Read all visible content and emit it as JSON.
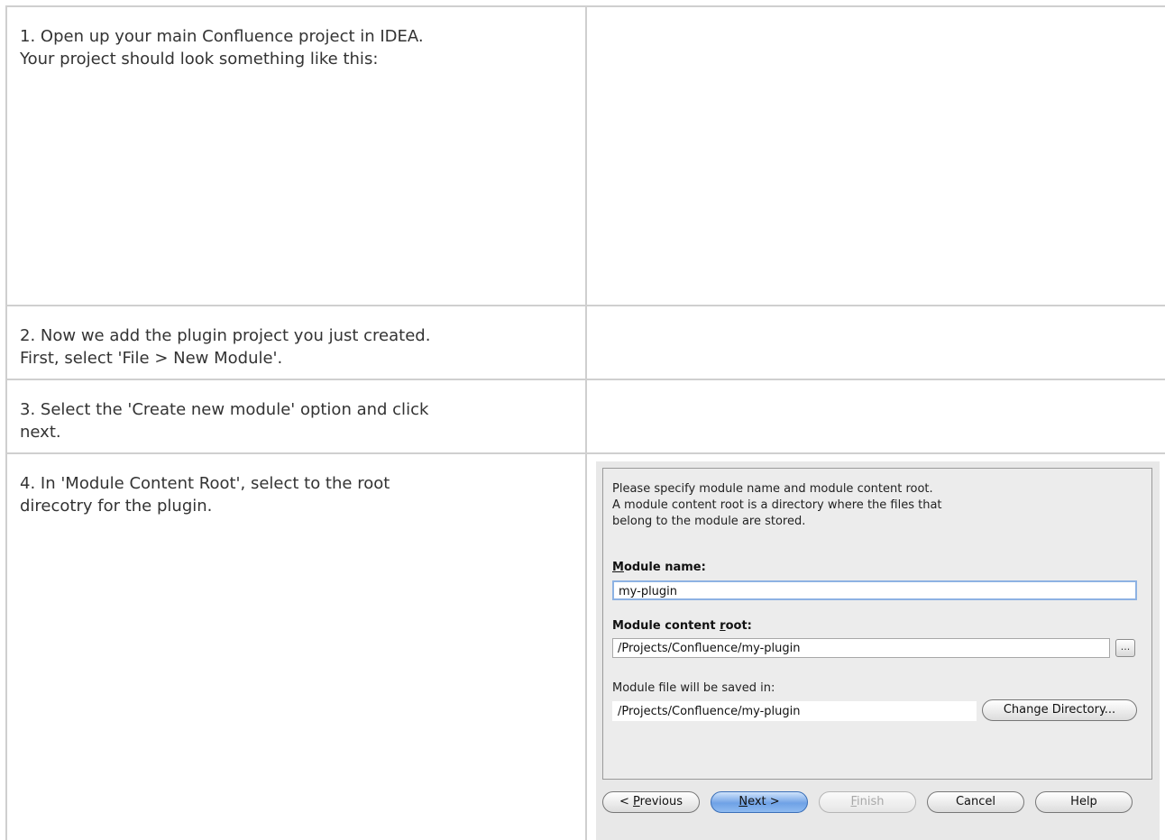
{
  "steps": [
    {
      "lines": [
        "1. Open up your main Confluence project in IDEA.",
        "Your project should look something like this:"
      ]
    },
    {
      "lines": [
        "2. Now we add the plugin project you just created.",
        "First, select 'File > New Module'."
      ]
    },
    {
      "lines": [
        "3. Select the 'Create new module' option and click",
        "next."
      ]
    },
    {
      "lines": [
        "4. In 'Module Content Root', select to the root",
        "direcotry for the plugin."
      ]
    }
  ],
  "dialog": {
    "description": [
      "Please specify module name and module content root.",
      "A module content root is a directory where the files that",
      "belong to the module are stored."
    ],
    "module_name_label_mnemonic": "M",
    "module_name_label_rest": "odule name:",
    "module_name_value": "my-plugin",
    "content_root_label_pre": "Module content ",
    "content_root_label_mnemonic": "r",
    "content_root_label_post": "oot:",
    "content_root_value": "/Projects/Confluence/my-plugin",
    "browse_label": "...",
    "saved_in_label": "Module file will be saved in:",
    "saved_in_value": "/Projects/Confluence/my-plugin",
    "change_directory_label": "Change Directory...",
    "buttons": {
      "previous_pre": "< ",
      "previous_mnemonic": "P",
      "previous_rest": "revious",
      "next_mnemonic": "N",
      "next_rest": "ext >",
      "finish_mnemonic": "F",
      "finish_rest": "inish",
      "cancel": "Cancel",
      "help": "Help"
    }
  }
}
